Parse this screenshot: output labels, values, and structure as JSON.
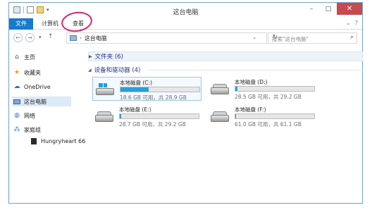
{
  "window": {
    "title": "这台电脑",
    "controls": {
      "minimize": "–",
      "maximize": "□",
      "close": "✕"
    }
  },
  "ribbon": {
    "tabs": [
      {
        "label": "文件"
      },
      {
        "label": "计算机"
      },
      {
        "label": "查看"
      }
    ],
    "collapse": "⌄",
    "help": "?"
  },
  "nav": {
    "back": "←",
    "forward": "→",
    "recent": "▾",
    "up": "↑",
    "breadcrumb_sep": "›",
    "address": "这台电脑",
    "address_dropdown": "⌄",
    "refresh": "↻",
    "search_placeholder": "搜索\"这台电脑\"",
    "search_icon": "⌕"
  },
  "sidebar": {
    "items": [
      {
        "label": "主页",
        "icon": "home-icon"
      },
      {
        "label": "收藏夹",
        "icon": "star-icon"
      },
      {
        "label": "OneDrive",
        "icon": "cloud-icon"
      },
      {
        "label": "这台电脑",
        "icon": "computer-icon"
      },
      {
        "label": "网络",
        "icon": "network-icon"
      },
      {
        "label": "家庭组",
        "icon": "homegroup-icon"
      },
      {
        "label": "Hungryheart 66",
        "icon": "user-icon"
      }
    ]
  },
  "content": {
    "folders_group": "文件夹 (6)",
    "devices_group": "设备和驱动器 (4)",
    "drives": [
      {
        "name": "本地磁盘 (C:)",
        "free": "18.6 GB 可用，共 28.9 GB",
        "used_fraction": 0.36,
        "system": true
      },
      {
        "name": "本地磁盘 (D:)",
        "free": "28.5 GB 可用，共 29.2 GB",
        "used_fraction": 0.03,
        "system": false
      },
      {
        "name": "本地磁盘 (E:)",
        "free": "28.7 GB 可用，共 29.2 GB",
        "used_fraction": 0.02,
        "system": false
      },
      {
        "name": "本地磁盘 (F:)",
        "free": "61.0 GB 可用，共 61.1 GB",
        "used_fraction": 0.01,
        "system": false
      }
    ]
  },
  "colors": {
    "accent": "#1979ca",
    "bar_fill": "#26a0da",
    "annotation_circle": "#d6246e"
  }
}
